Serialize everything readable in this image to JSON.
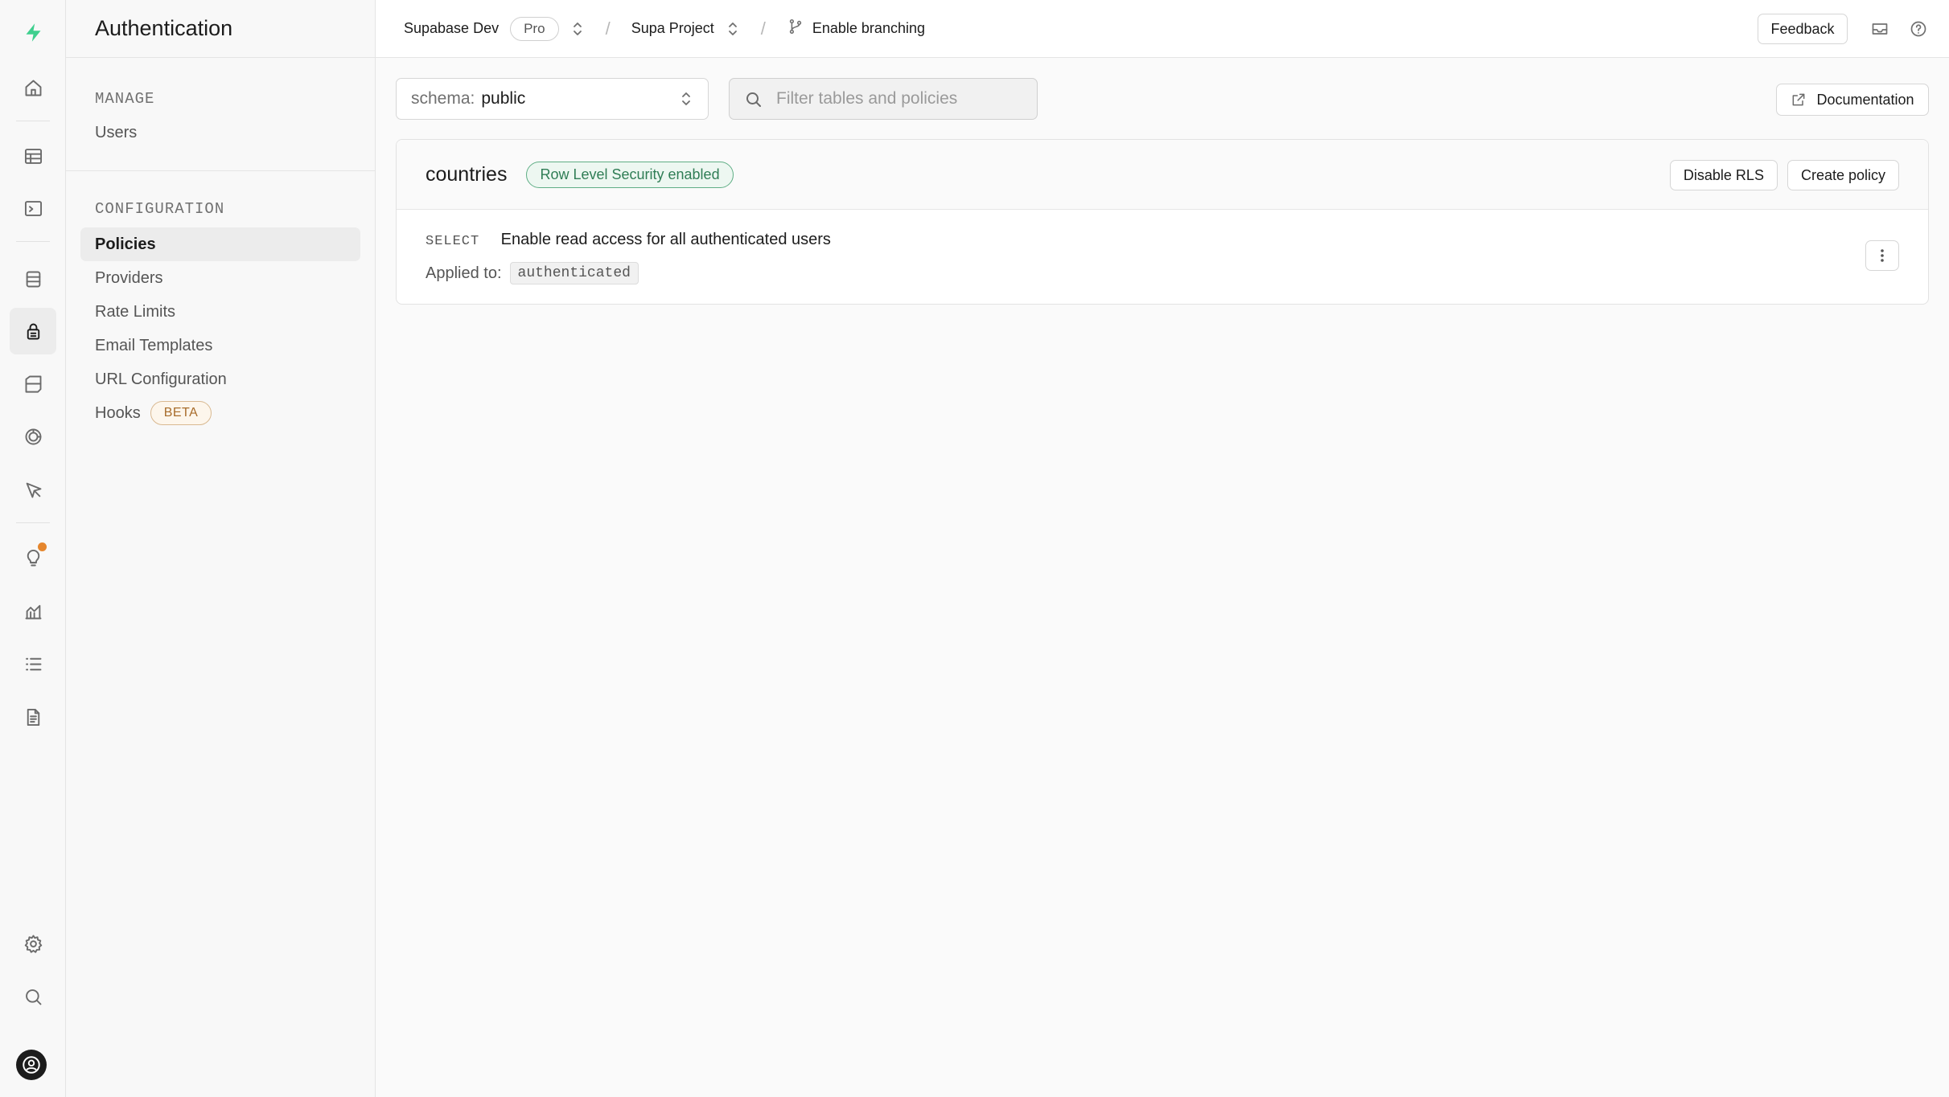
{
  "rail": {
    "items": [
      {
        "name": "logo",
        "icon": "supabase-bolt-icon"
      },
      {
        "name": "home",
        "icon": "home-icon"
      },
      {
        "name": "table-editor",
        "icon": "table-icon"
      },
      {
        "name": "sql-editor",
        "icon": "terminal-icon"
      },
      {
        "name": "database",
        "icon": "database-icon"
      },
      {
        "name": "authentication",
        "icon": "lock-icon",
        "active": true
      },
      {
        "name": "storage",
        "icon": "archive-icon"
      },
      {
        "name": "realtime",
        "icon": "realtime-icon"
      },
      {
        "name": "edge-functions",
        "icon": "cursor-icon"
      },
      {
        "name": "advisors",
        "icon": "lightbulb-icon"
      },
      {
        "name": "reports",
        "icon": "chart-icon"
      },
      {
        "name": "logs",
        "icon": "list-icon"
      },
      {
        "name": "api-docs",
        "icon": "document-icon"
      },
      {
        "name": "settings",
        "icon": "gear-icon"
      },
      {
        "name": "search",
        "icon": "search-icon"
      },
      {
        "name": "account",
        "icon": "avatar-icon"
      }
    ],
    "accent": "#3ecf8e",
    "notification_color": "#e5862d"
  },
  "sidebar": {
    "title": "Authentication",
    "manage": {
      "title": "MANAGE",
      "items": [
        {
          "label": "Users"
        }
      ]
    },
    "configuration": {
      "title": "CONFIGURATION",
      "items": [
        {
          "label": "Policies",
          "active": true
        },
        {
          "label": "Providers"
        },
        {
          "label": "Rate Limits"
        },
        {
          "label": "Email Templates"
        },
        {
          "label": "URL Configuration"
        },
        {
          "label": "Hooks",
          "badge": "BETA"
        }
      ]
    }
  },
  "topbar": {
    "org": "Supabase Dev",
    "plan": "Pro",
    "project": "Supa Project",
    "branching": "Enable branching",
    "feedback": "Feedback",
    "icons": [
      "inbox-icon",
      "help-icon"
    ]
  },
  "main": {
    "schema_label": "schema:",
    "schema_value": "public",
    "filter_placeholder": "Filter tables and policies",
    "documentation": "Documentation",
    "tables": [
      {
        "name": "countries",
        "rls_status": "Row Level Security enabled",
        "disable_label": "Disable RLS",
        "create_label": "Create policy",
        "policies": [
          {
            "command": "SELECT",
            "name": "Enable read access for all authenticated users",
            "applied_label": "Applied to:",
            "role": "authenticated"
          }
        ]
      }
    ]
  }
}
